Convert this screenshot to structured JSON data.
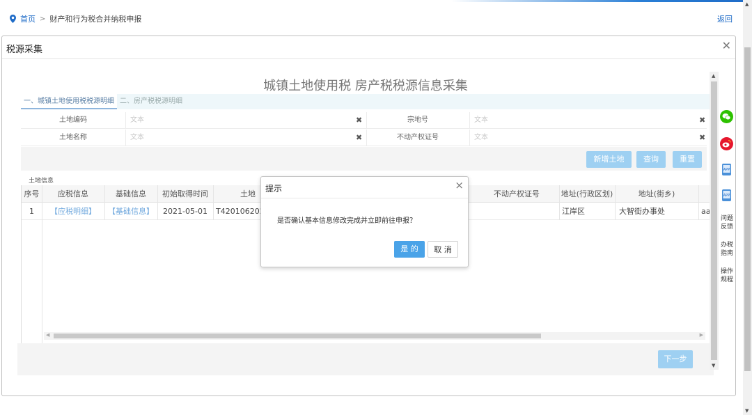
{
  "breadcrumb": {
    "home": "首页",
    "separator": ">",
    "current": "财产和行为税合并纳税申报"
  },
  "back_link": "返回",
  "dialog": {
    "title": "税源采集"
  },
  "page_heading": "城镇土地使用税 房产税税源信息采集",
  "tabs": [
    {
      "label": "一、城镇土地使用税税源明细",
      "active": true
    },
    {
      "label": "二、房产税税源明细",
      "active": false
    }
  ],
  "filters": {
    "row1": [
      {
        "label": "土地编码",
        "placeholder": "文本",
        "clear": "✖"
      },
      {
        "label": "宗地号",
        "placeholder": "文本",
        "clear": "✖"
      }
    ],
    "row2": [
      {
        "label": "土地名称",
        "placeholder": "文本",
        "clear": "✖"
      },
      {
        "label": "不动产权证号",
        "placeholder": "文本",
        "clear": "✖"
      }
    ]
  },
  "buttons": {
    "add_land": "新增土地",
    "query": "查询",
    "reset": "重置"
  },
  "section_label": "土地信息",
  "table": {
    "headers": [
      "序号",
      "应税信息",
      "基础信息",
      "初始取得时间",
      "土地",
      "不动产权证号",
      "地址(行政区划)",
      "地址(街乡)"
    ],
    "row": {
      "index": "1",
      "tax_info": "【应税明细】",
      "basic_info": "【基础信息】",
      "acquire_date": "2021-05-01",
      "land_code": "T42010620211",
      "district": "江岸区",
      "street": "大智街办事处",
      "extra": "aa"
    }
  },
  "next_button": "下一步",
  "modal": {
    "title": "提示",
    "message": "是否确认基本信息修改完成并立即前往申报？",
    "confirm": "是 的",
    "cancel": "取 消",
    "close": "×"
  },
  "sidebar": {
    "items": [
      "问题反馈",
      "办税指南",
      "操作规程"
    ],
    "icons": [
      "wechat-icon",
      "weibo-icon",
      "app-icon",
      "app-icon"
    ],
    "app_label": "APP"
  },
  "colors": {
    "accent": "#4aa3e8",
    "link": "#1e6bc7",
    "disabled_button": "#9ed0f2",
    "wechat": "#2dc100",
    "weibo": "#e6162d"
  }
}
